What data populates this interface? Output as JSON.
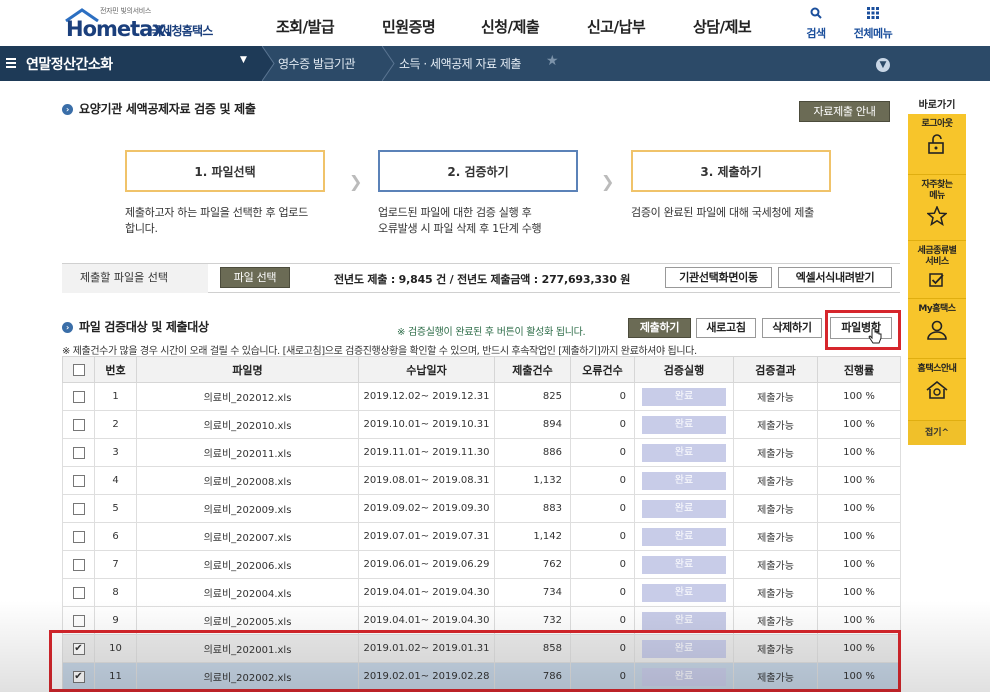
{
  "header": {
    "logo_sub": "전자민 빛의서비스",
    "logo_home": "Hometax.",
    "logo_ko": "국세청홈택스",
    "menu": [
      "조회/발급",
      "민원증명",
      "신청/제출",
      "신고/납부",
      "상담/제보"
    ],
    "search_label": "검색",
    "allmenu_label": "전체메뉴"
  },
  "nav": {
    "current": "연말정산간소화",
    "crumbs": [
      "영수증 발급기관",
      "소득 · 세액공제 자료 제출"
    ]
  },
  "section1": {
    "title": "요양기관 세액공제자료 검증 및 제출",
    "guide_button": "자료제출 안내",
    "steps": [
      {
        "label": "1. 파일선택",
        "desc": "제출하고자 하는 파일을 선택한 후 업로드\n합니다."
      },
      {
        "label": "2. 검증하기",
        "desc": "업로드된 파일에 대한 검증 실행 후\n오류발생 시 파일 삭제 후 1단계 수행"
      },
      {
        "label": "3. 제출하기",
        "desc": "검증이 완료된 파일에 대해 국세청에 제출"
      }
    ]
  },
  "file_select": {
    "label": "제출할 파일을 선택",
    "button": "파일 선택",
    "info": "전년도 제출 :   9,845  건 / 전년도 제출금액 :   277,693,330  원",
    "btn_inst": "기관선택화면이동",
    "btn_excel": "엑셀서식내려받기"
  },
  "section2": {
    "title": "파일 검증대상 및 제출대상",
    "note": "※ 검증실행이 완료된 후 버튼이 활성화 됩니다.",
    "buttons": [
      "제출하기",
      "새로고침",
      "삭제하기",
      "파일병합"
    ],
    "notice": "※ 제출건수가 많을 경우 시간이 오래 걸릴 수 있습니다. [새로고침]으로 검증진행상황을 확인할 수 있으며, 반드시 후속작업인 [제출하기]까지 완료하셔야 됩니다."
  },
  "table": {
    "headers": [
      "번호",
      "파일명",
      "수납일자",
      "제출건수",
      "오류건수",
      "검증실행",
      "검증결과",
      "진행률"
    ],
    "rows": [
      {
        "no": "1",
        "file": "의료비_202012.xls",
        "date": "2019.12.02~ 2019.12.31",
        "count": "825",
        "err": "0",
        "run": "완료",
        "result": "제출가능",
        "progress": "100 %",
        "checked": false
      },
      {
        "no": "2",
        "file": "의료비_202010.xls",
        "date": "2019.10.01~ 2019.10.31",
        "count": "894",
        "err": "0",
        "run": "완료",
        "result": "제출가능",
        "progress": "100 %",
        "checked": false
      },
      {
        "no": "3",
        "file": "의료비_202011.xls",
        "date": "2019.11.01~ 2019.11.30",
        "count": "886",
        "err": "0",
        "run": "완료",
        "result": "제출가능",
        "progress": "100 %",
        "checked": false
      },
      {
        "no": "4",
        "file": "의료비_202008.xls",
        "date": "2019.08.01~ 2019.08.31",
        "count": "1,132",
        "err": "0",
        "run": "완료",
        "result": "제출가능",
        "progress": "100 %",
        "checked": false
      },
      {
        "no": "5",
        "file": "의료비_202009.xls",
        "date": "2019.09.02~ 2019.09.30",
        "count": "883",
        "err": "0",
        "run": "완료",
        "result": "제출가능",
        "progress": "100 %",
        "checked": false
      },
      {
        "no": "6",
        "file": "의료비_202007.xls",
        "date": "2019.07.01~ 2019.07.31",
        "count": "1,142",
        "err": "0",
        "run": "완료",
        "result": "제출가능",
        "progress": "100 %",
        "checked": false
      },
      {
        "no": "7",
        "file": "의료비_202006.xls",
        "date": "2019.06.01~ 2019.06.29",
        "count": "762",
        "err": "0",
        "run": "완료",
        "result": "제출가능",
        "progress": "100 %",
        "checked": false
      },
      {
        "no": "8",
        "file": "의료비_202004.xls",
        "date": "2019.04.01~ 2019.04.30",
        "count": "734",
        "err": "0",
        "run": "완료",
        "result": "제출가능",
        "progress": "100 %",
        "checked": false
      },
      {
        "no": "9",
        "file": "의료비_202005.xls",
        "date": "2019.04.01~ 2019.04.30",
        "count": "732",
        "err": "0",
        "run": "완료",
        "result": "제출가능",
        "progress": "100 %",
        "checked": false
      },
      {
        "no": "10",
        "file": "의료비_202001.xls",
        "date": "2019.01.02~ 2019.01.31",
        "count": "858",
        "err": "0",
        "run": "완료",
        "result": "제출가능",
        "progress": "100 %",
        "checked": true
      },
      {
        "no": "11",
        "file": "의료비_202002.xls",
        "date": "2019.02.01~ 2019.02.28",
        "count": "786",
        "err": "0",
        "run": "완료",
        "result": "제출가능",
        "progress": "100 %",
        "checked": true
      }
    ]
  },
  "quick": {
    "title": "바로가기",
    "items": [
      "로그아웃",
      "자주찾는\n메뉴",
      "세금종류별\n서비스",
      "My홈택스",
      "홈택스안내"
    ],
    "close": "접기^"
  },
  "colors": {
    "nav_bg": "#2c4a68",
    "quick_bg": "#f7c52b",
    "highlight": "#d6262c",
    "olive_button": "#6b6b55"
  }
}
